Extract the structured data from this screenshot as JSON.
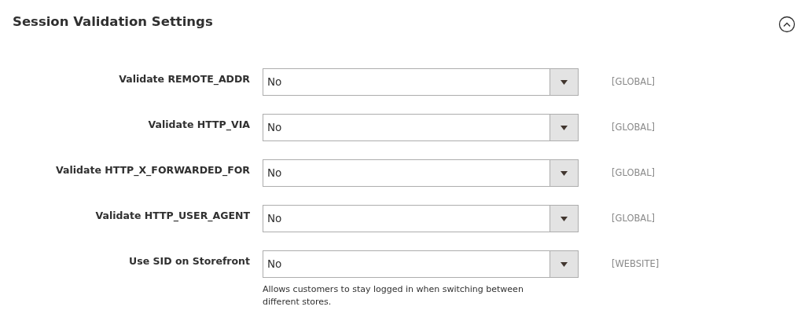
{
  "section": {
    "title": "Session Validation Settings",
    "expanded": true
  },
  "fields": [
    {
      "label": "Validate REMOTE_ADDR",
      "value": "No",
      "scope": "[GLOBAL]"
    },
    {
      "label": "Validate HTTP_VIA",
      "value": "No",
      "scope": "[GLOBAL]"
    },
    {
      "label": "Validate HTTP_X_FORWARDED_FOR",
      "value": "No",
      "scope": "[GLOBAL]"
    },
    {
      "label": "Validate HTTP_USER_AGENT",
      "value": "No",
      "scope": "[GLOBAL]"
    },
    {
      "label": "Use SID on Storefront",
      "value": "No",
      "scope": "[WEBSITE]",
      "note": "Allows customers to stay logged in when switching between different stores."
    }
  ]
}
